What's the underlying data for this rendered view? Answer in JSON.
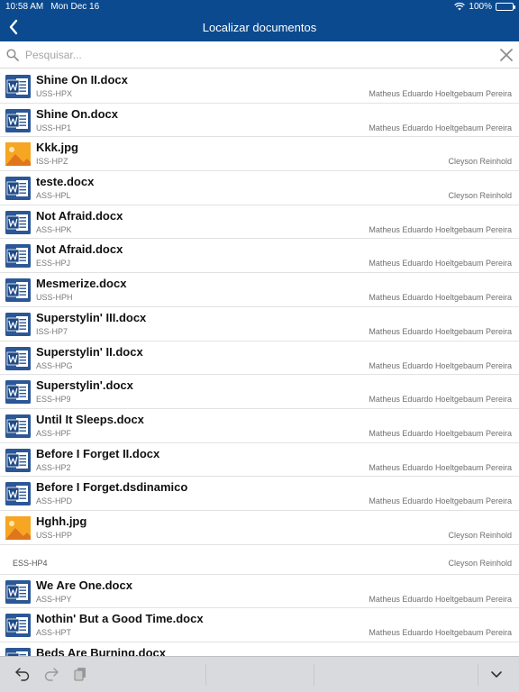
{
  "status": {
    "time": "10:58 AM",
    "date": "Mon Dec 16",
    "battery": "100%",
    "battery_level": 1.0
  },
  "nav": {
    "title": "Localizar documentos"
  },
  "search": {
    "placeholder": "Pesquisar..."
  },
  "rows": [
    {
      "name": "Shine On II.docx",
      "code": "USS-HPX",
      "owner": "Matheus Eduardo Hoeltgebaum Pereira",
      "icon": "word-icon"
    },
    {
      "name": "Shine On.docx",
      "code": "USS-HP1",
      "owner": "Matheus Eduardo Hoeltgebaum Pereira",
      "icon": "word-icon"
    },
    {
      "name": "Kkk.jpg",
      "code": "ISS-HPZ",
      "owner": "Cleyson Reinhold",
      "icon": "image-icon"
    },
    {
      "name": "teste.docx",
      "code": "ASS-HPL",
      "owner": "Cleyson Reinhold",
      "icon": "word-icon"
    },
    {
      "name": "Not Afraid.docx",
      "code": "ASS-HPK",
      "owner": "Matheus Eduardo Hoeltgebaum Pereira",
      "icon": "word-icon"
    },
    {
      "name": "Not Afraid.docx",
      "code": "ESS-HPJ",
      "owner": "Matheus Eduardo Hoeltgebaum Pereira",
      "icon": "word-icon"
    },
    {
      "name": "Mesmerize.docx",
      "code": "USS-HPH",
      "owner": "Matheus Eduardo Hoeltgebaum Pereira",
      "icon": "word-icon"
    },
    {
      "name": "Superstylin' III.docx",
      "code": "ISS-HP7",
      "owner": "Matheus Eduardo Hoeltgebaum Pereira",
      "icon": "word-icon"
    },
    {
      "name": "Superstylin' II.docx",
      "code": "ASS-HPG",
      "owner": "Matheus Eduardo Hoeltgebaum Pereira",
      "icon": "word-icon"
    },
    {
      "name": "Superstylin'.docx",
      "code": "ESS-HP9",
      "owner": "Matheus Eduardo Hoeltgebaum Pereira",
      "icon": "word-icon"
    },
    {
      "name": "Until It Sleeps.docx",
      "code": "ASS-HPF",
      "owner": "Matheus Eduardo Hoeltgebaum Pereira",
      "icon": "word-icon"
    },
    {
      "name": "Before I Forget II.docx",
      "code": "ASS-HP2",
      "owner": "Matheus Eduardo Hoeltgebaum Pereira",
      "icon": "word-icon"
    },
    {
      "name": "Before I Forget.dsdinamico",
      "code": "ASS-HPD",
      "owner": "Matheus Eduardo Hoeltgebaum Pereira",
      "icon": "word-icon"
    },
    {
      "name": "Hghh.jpg",
      "code": "USS-HPP",
      "owner": "Cleyson Reinhold",
      "icon": "image-icon"
    }
  ],
  "group": {
    "label": "ESS-HP4",
    "owner": "Cleyson Reinhold"
  },
  "rows2": [
    {
      "name": "We Are One.docx",
      "code": "ASS-HPY",
      "owner": "Matheus Eduardo Hoeltgebaum Pereira",
      "icon": "word-icon"
    },
    {
      "name": "Nothin' But a Good Time.docx",
      "code": "ASS-HPT",
      "owner": "Matheus Eduardo Hoeltgebaum Pereira",
      "icon": "word-icon"
    },
    {
      "name": "Beds Are Burning.docx",
      "code": "",
      "owner": "",
      "icon": "word-icon"
    }
  ],
  "toolbar": {
    "icons": [
      "undo-icon",
      "redo-icon",
      "copy-icon",
      "chevron-down-icon"
    ]
  },
  "colors": {
    "navbar": "#0b4a8f",
    "word": "#2b5796",
    "toolbar": "#d9dadd"
  }
}
